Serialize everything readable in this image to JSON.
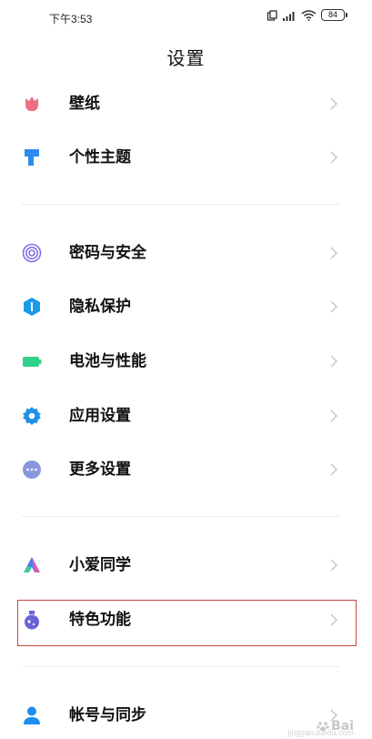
{
  "status_bar": {
    "time": "下午3:53",
    "battery": "84"
  },
  "page_title": "设置",
  "sections": [
    {
      "items": [
        {
          "label": "壁纸",
          "icon": "tulip-icon",
          "color": "#ec6f82"
        },
        {
          "label": "个性主题",
          "icon": "paint-brush-icon",
          "color": "#2d8bf0"
        }
      ]
    },
    {
      "items": [
        {
          "label": "密码与安全",
          "icon": "fingerprint-icon",
          "color": "#7f6ee8"
        },
        {
          "label": "隐私保护",
          "icon": "shield-icon",
          "color": "#1a9ae8"
        },
        {
          "label": "电池与性能",
          "icon": "battery-icon",
          "color": "#2fd18a"
        },
        {
          "label": "应用设置",
          "icon": "gear-icon",
          "color": "#1f8fe6"
        },
        {
          "label": "更多设置",
          "icon": "more-dots-icon",
          "color": "#8a96dc"
        }
      ]
    },
    {
      "items": [
        {
          "label": "小爱同学",
          "icon": "xiaoai-icon",
          "color": "#4a7bf2"
        },
        {
          "label": "特色功能",
          "icon": "flask-icon",
          "color": "#6a62d8"
        }
      ]
    },
    {
      "items": [
        {
          "label": "帐号与同步",
          "icon": "account-icon",
          "color": "#1a8ff0"
        }
      ]
    }
  ],
  "watermark": {
    "text": "Bai",
    "sub": "jingyan.baidu.com"
  }
}
